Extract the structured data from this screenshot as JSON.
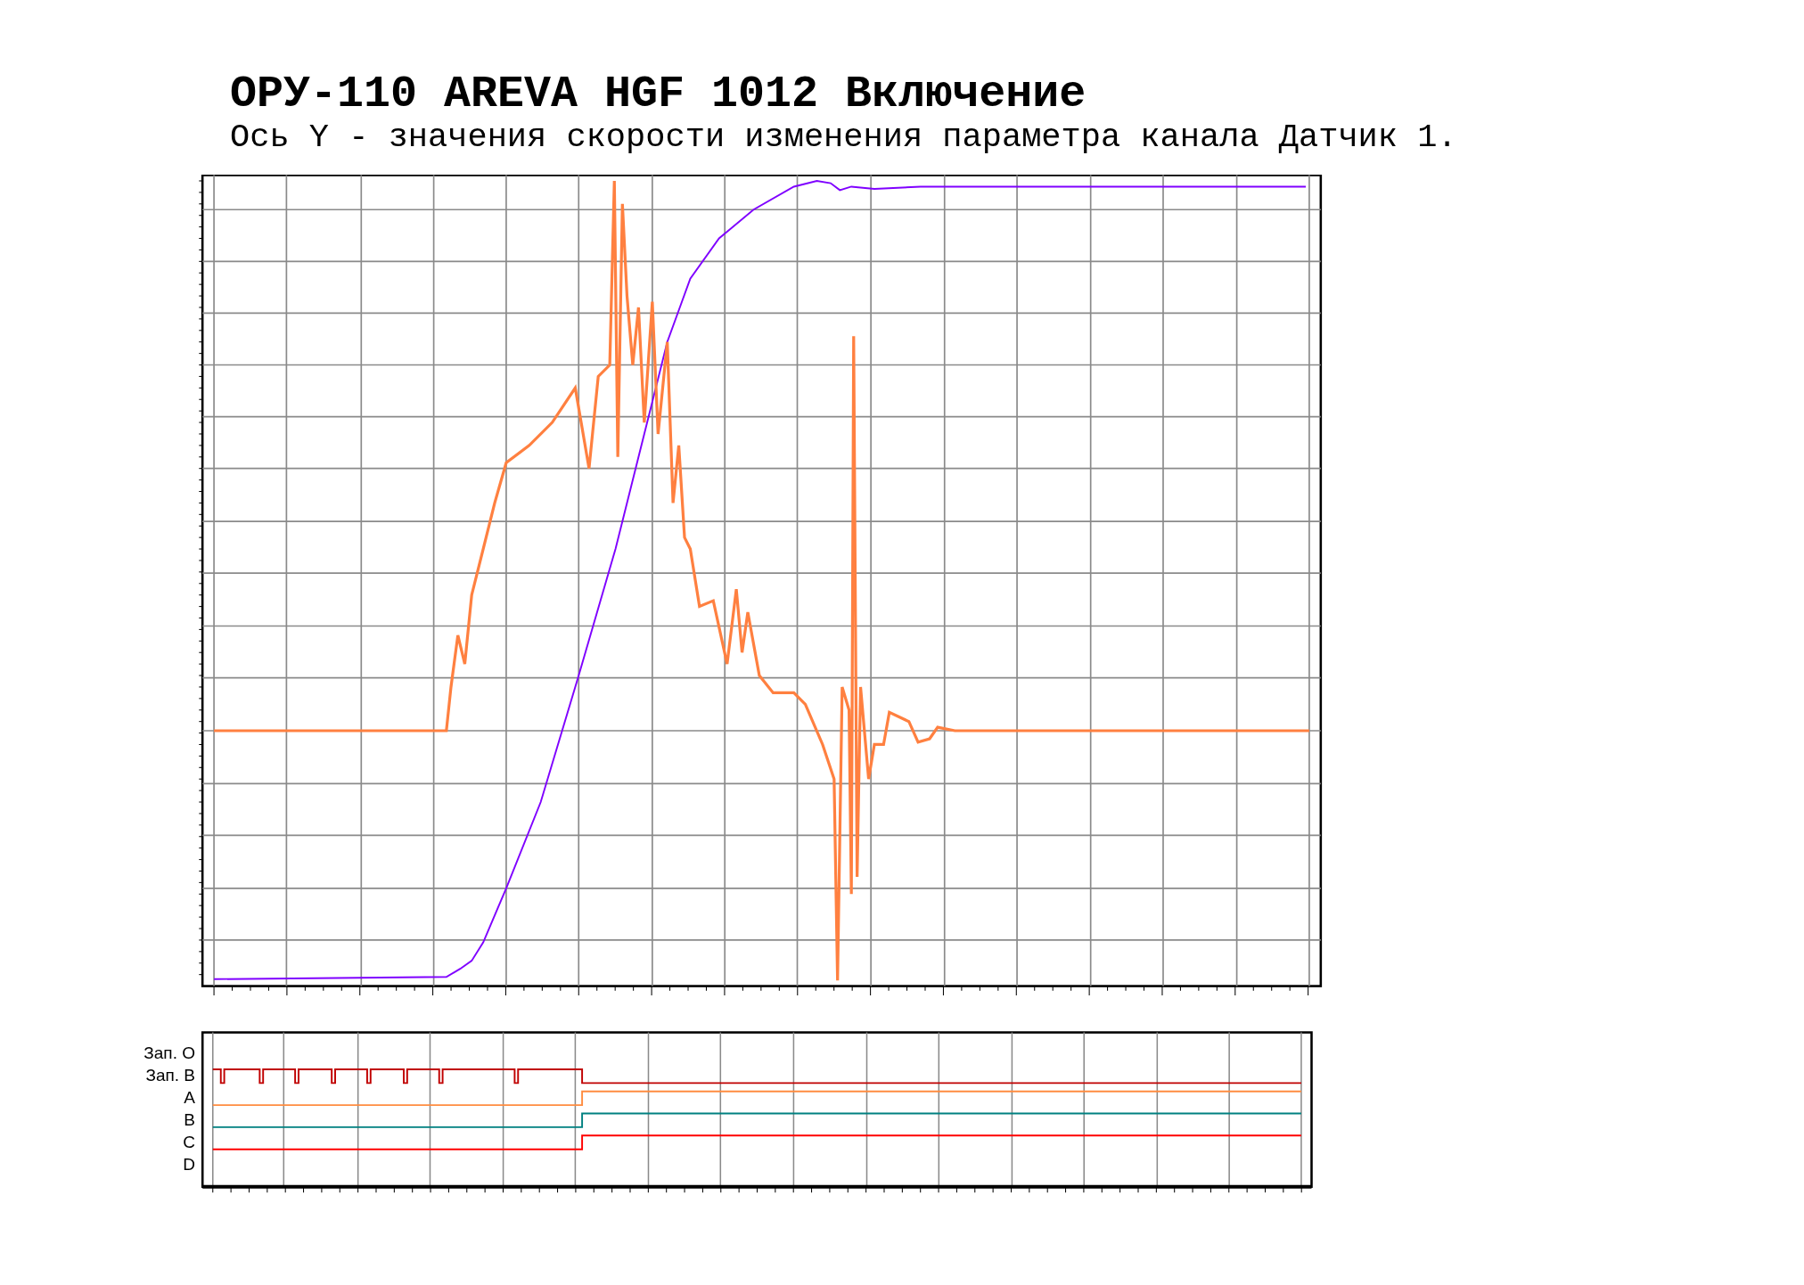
{
  "title": "ОРУ-110 AREVA HGF 1012 Включение",
  "subtitle": "Ось Y - значения скорости изменения параметра канала Датчик 1.",
  "digital_channels": [
    {
      "label": "Зап. О"
    },
    {
      "label": "Зап. В",
      "color": "#c00000"
    },
    {
      "label": "A",
      "color": "#ff8c40"
    },
    {
      "label": "B",
      "color": "#008080"
    },
    {
      "label": "C",
      "color": "#ff0000"
    },
    {
      "label": "D"
    }
  ]
}
